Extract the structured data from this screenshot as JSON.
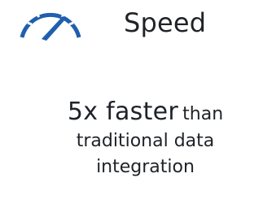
{
  "header": {
    "icon": "speedometer-icon",
    "title": "Speed",
    "accent_color": "#1f5fae"
  },
  "stat": {
    "highlight": "5x faster",
    "suffix": "than",
    "line2": "traditional data",
    "line3": "integration"
  }
}
